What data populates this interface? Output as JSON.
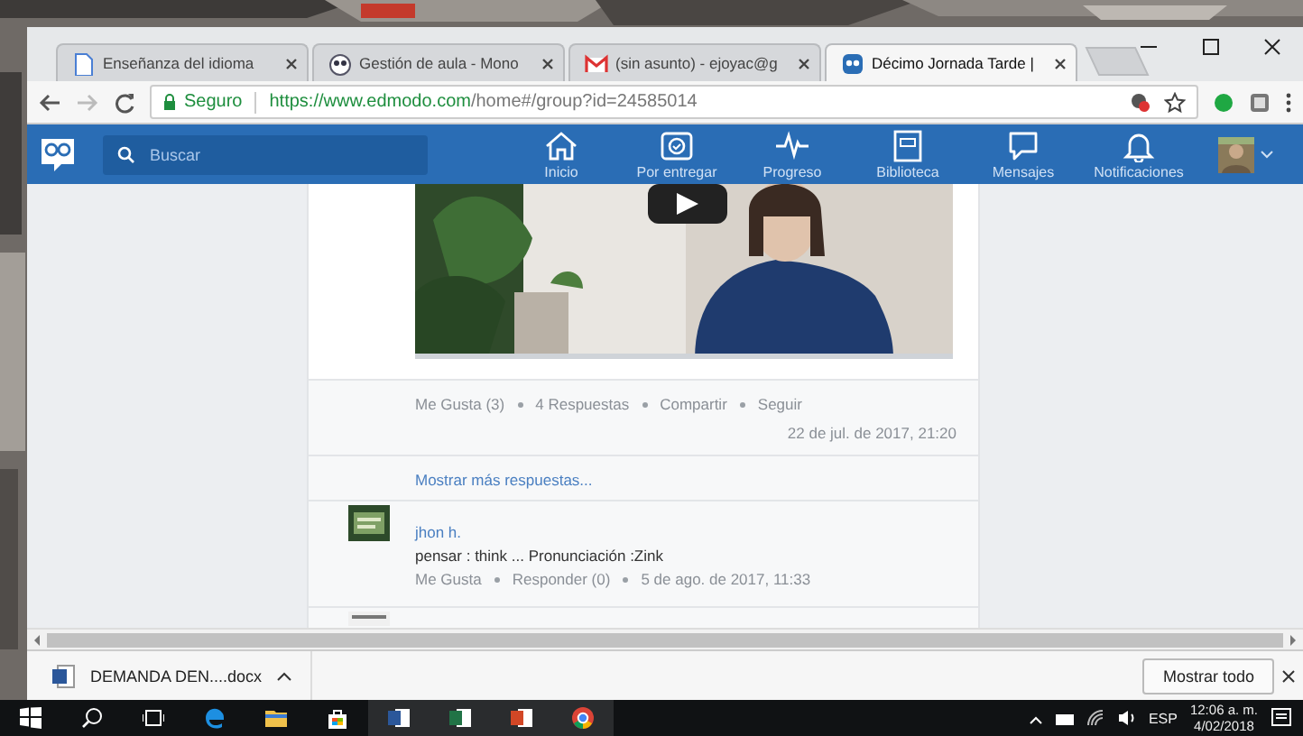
{
  "browser": {
    "tabs": [
      {
        "title": "Enseñanza del idioma",
        "selected": false
      },
      {
        "title": "Gestión de aula - Mono",
        "selected": false
      },
      {
        "title": "(sin asunto) - ejoyac@g",
        "selected": false
      },
      {
        "title": "Décimo Jornada Tarde |",
        "selected": true
      }
    ],
    "security": "Seguro",
    "url_host": "https://www.edmodo.com",
    "url_path": "/home#/group?id=24585014"
  },
  "app": {
    "search": {
      "placeholder": "Buscar"
    },
    "nav": [
      {
        "label": "Inicio"
      },
      {
        "label": "Por entregar"
      },
      {
        "label": "Progreso"
      },
      {
        "label": "Biblioteca"
      },
      {
        "label": "Mensajes"
      },
      {
        "label": "Notificaciones"
      }
    ]
  },
  "post": {
    "actions": [
      "Me Gusta (3)",
      "4 Respuestas",
      "Compartir",
      "Seguir"
    ],
    "timestamp": "22 de jul. de 2017, 21:20",
    "more_replies": "Mostrar más respuestas...",
    "replies": [
      {
        "author": "jhon h.",
        "text": "pensar : think ... Pronunciación :Zink",
        "actions": [
          "Me Gusta",
          "Responder (0)",
          "5 de ago. de 2017, 11:33"
        ]
      }
    ]
  },
  "downloads": {
    "file": "DEMANDA  DEN....docx",
    "show_all": "Mostrar todo"
  },
  "taskbar": {
    "language": "ESP",
    "time": "12:06 a. m.",
    "date": "4/02/2018"
  }
}
